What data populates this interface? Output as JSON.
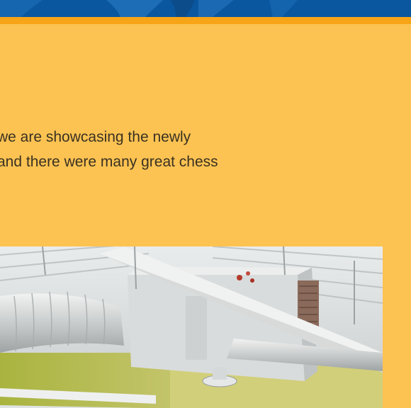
{
  "article": {
    "paragraph_lines": [
      "we are showcasing the newly",
      "and there were many great chess"
    ]
  },
  "photo": {
    "subject": "ceiling-ductwork-photo"
  },
  "colors": {
    "header_blue": "#0a57a0",
    "accent_orange": "#f7a417",
    "panel_yellow": "#fcc352",
    "text": "#3a3122"
  }
}
